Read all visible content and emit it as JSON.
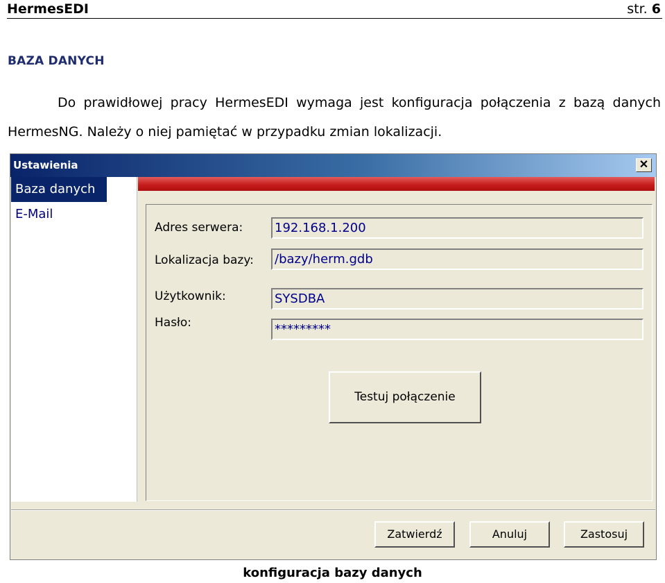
{
  "header": {
    "brand": "HermesEDI",
    "page_prefix": "str. ",
    "page_number": "6"
  },
  "section_title": "BAZA DANYCH",
  "paragraph": "Do prawidłowej pracy HermesEDI wymaga jest konfiguracja połączenia z bazą danych HermesNG. Należy o niej pamiętać w przypadku zmian lokalizacji.",
  "dialog": {
    "title": "Ustawienia",
    "close_symbol": "✕",
    "sidebar": [
      {
        "label": "Baza danych",
        "active": true
      },
      {
        "label": "E-Mail",
        "active": false
      }
    ],
    "fields": {
      "server_label": "Adres serwera:",
      "server_value": "192.168.1.200",
      "location_label": "Lokalizacja bazy:",
      "location_value": "/bazy/herm.gdb",
      "user_label": "Użytkownik:",
      "user_value": "SYSDBA",
      "password_label": "Hasło:",
      "password_value": "*********"
    },
    "test_button": "Testuj połączenie",
    "buttons": {
      "confirm": "Zatwierdź",
      "cancel": "Anuluj",
      "apply": "Zastosuj"
    },
    "colors": {
      "title_gradient_start": "#0a246a",
      "accent_red": "#c41a1a",
      "field_text": "#00008b"
    }
  },
  "caption": "konfiguracja bazy danych"
}
